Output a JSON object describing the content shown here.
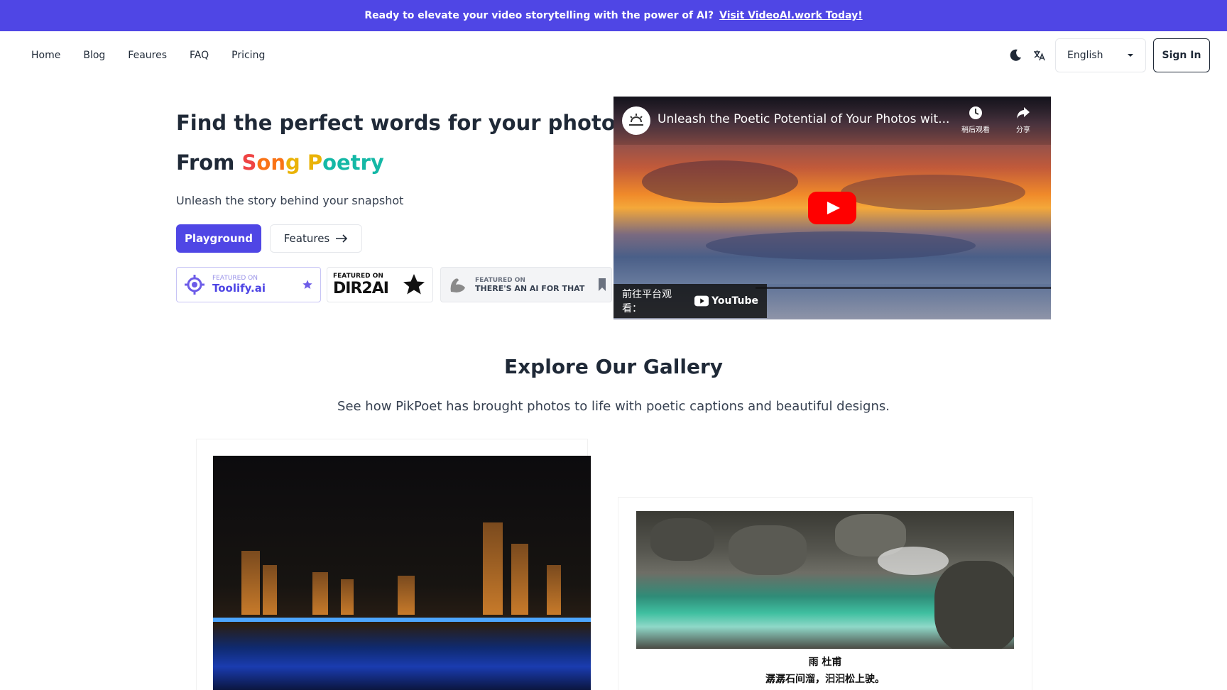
{
  "banner": {
    "text": "Ready to elevate your video storytelling with the power of AI?",
    "link": "Visit VideoAI.work Today!"
  },
  "nav": {
    "links": [
      "Home",
      "Blog",
      "Feaures",
      "FAQ",
      "Pricing"
    ],
    "language": "English",
    "sign_in": "Sign In"
  },
  "hero": {
    "title": "Find the perfect words for your photos",
    "from": "From",
    "highlight": [
      "S",
      "o",
      "n",
      "g",
      " P",
      "oetry"
    ],
    "subtitle": "Unleash the story behind your snapshot",
    "primary_button": "Playground",
    "secondary_button": "Features"
  },
  "badges": {
    "toolify": {
      "small": "FEATURED ON",
      "name": "Toolify.ai"
    },
    "dir2ai": {
      "small": "FEATURED ON",
      "name": "DIR2AI"
    },
    "taaft": {
      "small": "FEATURED ON",
      "name": "THERE'S AN AI FOR THAT"
    }
  },
  "video": {
    "title": "Unleash the Poetic Potential of Your Photos wit...",
    "watch_later": "稍后观看",
    "share": "分享",
    "watch_on": "前往平台观看：",
    "platform": "YouTube"
  },
  "gallery": {
    "title": "Explore Our Gallery",
    "subtitle": "See how PikPoet has brought photos to life with poetic captions and beautiful designs.",
    "poem_title": "雨 杜甫",
    "poem_line": "潺潺石间溜，汩汩松上驶。"
  },
  "colors": {
    "accent": "#4f46e5",
    "banner": "#4f46e5"
  }
}
